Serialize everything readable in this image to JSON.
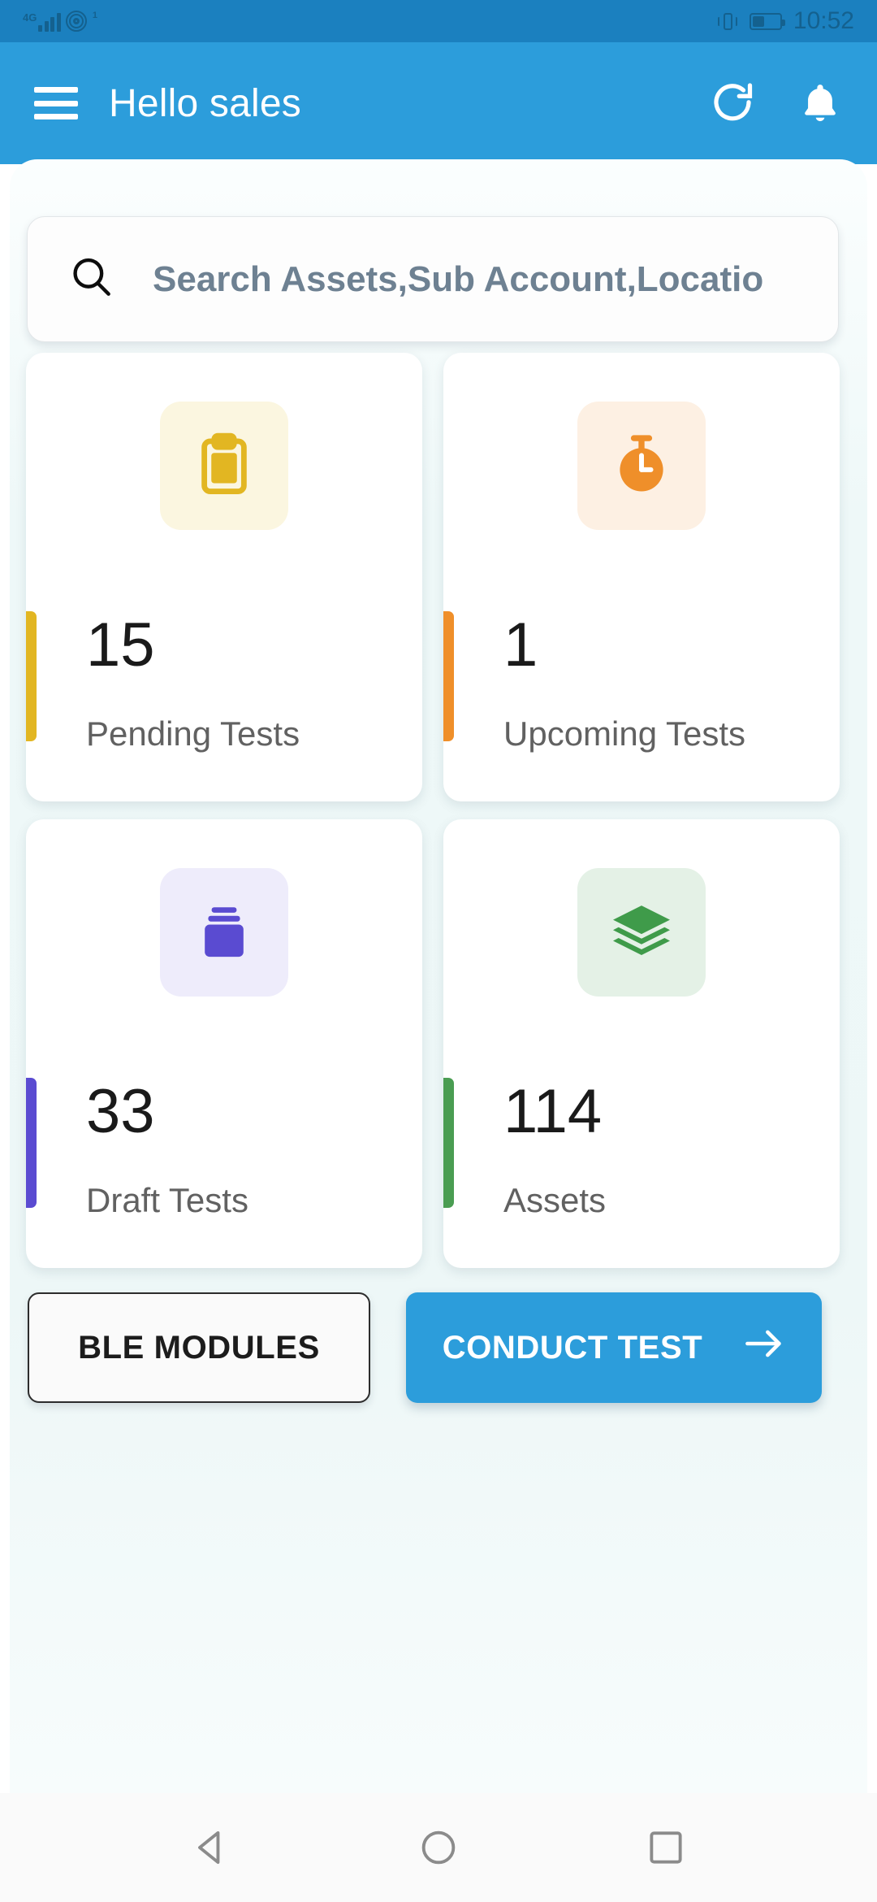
{
  "status_bar": {
    "network_label": "4G",
    "hotspot_badge": "1",
    "time": "10:52",
    "battery_percent": 38,
    "icons": [
      "signal-bars-icon",
      "hotspot-icon",
      "vibrate-icon",
      "battery-icon"
    ]
  },
  "app_bar": {
    "title": "Hello sales",
    "menu_icon": "hamburger-menu-icon",
    "refresh_icon": "refresh-icon",
    "notification_icon": "bell-icon"
  },
  "search": {
    "placeholder": "Search Assets,Sub Account,Locatio",
    "value": "",
    "icon": "search-icon"
  },
  "stats": {
    "cards": [
      {
        "value": "15",
        "label": "Pending Tests",
        "icon": "clipboard-icon",
        "accent_color": "#e2b622",
        "icon_color": "#e2b622",
        "icon_bg": "#fbf6e0"
      },
      {
        "value": "1",
        "label": "Upcoming Tests",
        "icon": "stopwatch-icon",
        "accent_color": "#ef8f2a",
        "icon_color": "#ef8f2a",
        "icon_bg": "#fdf0e3"
      },
      {
        "value": "33",
        "label": "Draft Tests",
        "icon": "archive-box-icon",
        "accent_color": "#5a4bd1",
        "icon_color": "#5a4bd1",
        "icon_bg": "#eeecfb"
      },
      {
        "value": "114",
        "label": "Assets",
        "icon": "layers-icon",
        "accent_color": "#4a9d52",
        "icon_color": "#3f9b4a",
        "icon_bg": "#e4f1e6"
      }
    ]
  },
  "actions": {
    "ble_modules_label": "BLE MODULES",
    "conduct_test_label": "CONDUCT TEST",
    "conduct_test_icon": "arrow-right-icon"
  },
  "nav_bar": {
    "back_icon": "triangle-back-icon",
    "home_icon": "circle-home-icon",
    "recents_icon": "square-recents-icon"
  },
  "theme": {
    "primary": "#2c9ddb",
    "status_bar_bg": "#1b80bf",
    "sheet_bg": "#edf7f7"
  }
}
